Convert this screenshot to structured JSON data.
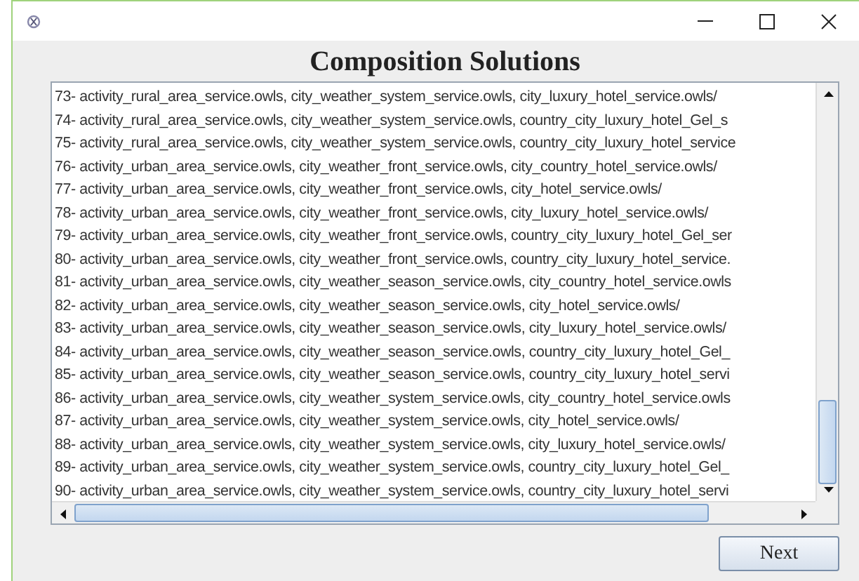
{
  "heading": "Composition Solutions",
  "solutions": [
    "73- activity_rural_area_service.owls, city_weather_system_service.owls, city_luxury_hotel_service.owls/",
    "74- activity_rural_area_service.owls, city_weather_system_service.owls, country_city_luxury_hotel_Gel_s",
    "75- activity_rural_area_service.owls, city_weather_system_service.owls, country_city_luxury_hotel_service",
    "76- activity_urban_area_service.owls, city_weather_front_service.owls, city_country_hotel_service.owls/",
    "77- activity_urban_area_service.owls, city_weather_front_service.owls, city_hotel_service.owls/",
    "78- activity_urban_area_service.owls, city_weather_front_service.owls, city_luxury_hotel_service.owls/",
    "79- activity_urban_area_service.owls, city_weather_front_service.owls, country_city_luxury_hotel_Gel_ser",
    "80- activity_urban_area_service.owls, city_weather_front_service.owls, country_city_luxury_hotel_service.",
    "81- activity_urban_area_service.owls, city_weather_season_service.owls, city_country_hotel_service.owls",
    "82- activity_urban_area_service.owls, city_weather_season_service.owls, city_hotel_service.owls/",
    "83- activity_urban_area_service.owls, city_weather_season_service.owls, city_luxury_hotel_service.owls/",
    "84- activity_urban_area_service.owls, city_weather_season_service.owls, country_city_luxury_hotel_Gel_",
    "85- activity_urban_area_service.owls, city_weather_season_service.owls, country_city_luxury_hotel_servi",
    "86- activity_urban_area_service.owls, city_weather_system_service.owls, city_country_hotel_service.owls",
    "87- activity_urban_area_service.owls, city_weather_system_service.owls, city_hotel_service.owls/",
    "88- activity_urban_area_service.owls, city_weather_system_service.owls, city_luxury_hotel_service.owls/",
    "89- activity_urban_area_service.owls, city_weather_system_service.owls, country_city_luxury_hotel_Gel_",
    "90- activity_urban_area_service.owls, city_weather_system_service.owls, country_city_luxury_hotel_servi"
  ],
  "buttons": [
    "Next"
  ]
}
